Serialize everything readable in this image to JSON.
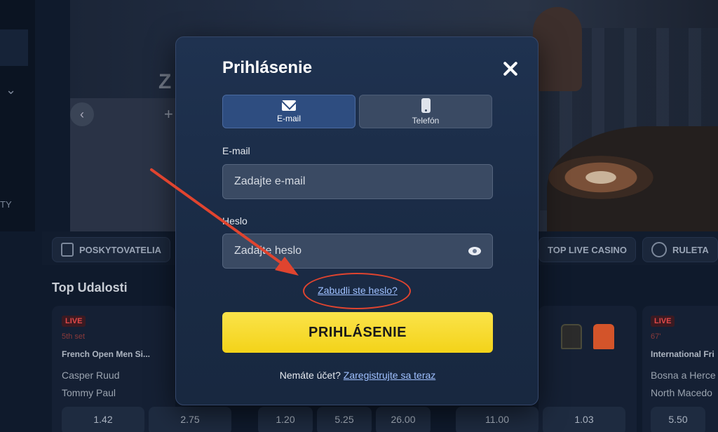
{
  "background": {
    "sidebar": {
      "truncated_text": "TY"
    },
    "banner": {
      "title_partial": "Z",
      "plus": "+"
    },
    "categories": [
      {
        "label": "POSKYTOVATELIA",
        "icon": "phone-icon"
      },
      {
        "label": "TOP LIVE CASINO",
        "icon": ""
      },
      {
        "label": "RULETA",
        "icon": "roulette-icon"
      }
    ],
    "section_title": "Top Udalosti",
    "events": [
      {
        "badge": "LIVE",
        "period": "5th set",
        "name": "French Open Men Si...",
        "team1": "Casper Ruud",
        "team2": "Tommy Paul",
        "odds": [
          "1.42",
          "2.75"
        ]
      },
      {
        "odds": [
          "1.20",
          "5.25",
          "26.00"
        ]
      },
      {
        "odds": [
          "11.00",
          "1.03"
        ]
      },
      {
        "badge": "LIVE",
        "period": "67'",
        "name": "International Fri",
        "team1": "Bosna a Herce",
        "team2": "North Macedo",
        "odds": [
          "5.50"
        ]
      }
    ]
  },
  "modal": {
    "title": "Prihlásenie",
    "tabs": [
      {
        "label": "E-mail",
        "icon": "mail-icon",
        "active": true
      },
      {
        "label": "Telefón",
        "icon": "phone-icon",
        "active": false
      }
    ],
    "email": {
      "label": "E-mail",
      "placeholder": "Zadajte e-mail",
      "value": ""
    },
    "password": {
      "label": "Heslo",
      "placeholder": "Zadajte heslo",
      "value": ""
    },
    "forgot_link": "Zabudli ste heslo?",
    "submit_label": "PRIHLÁSENIE",
    "register_prompt": "Nemáte účet?",
    "register_link": "Zaregistrujte sa teraz"
  },
  "colors": {
    "accent_button": "#f3d319",
    "link": "#9fc0ff",
    "annotation": "#e0442f",
    "modal_bg": "#1a2b45"
  }
}
